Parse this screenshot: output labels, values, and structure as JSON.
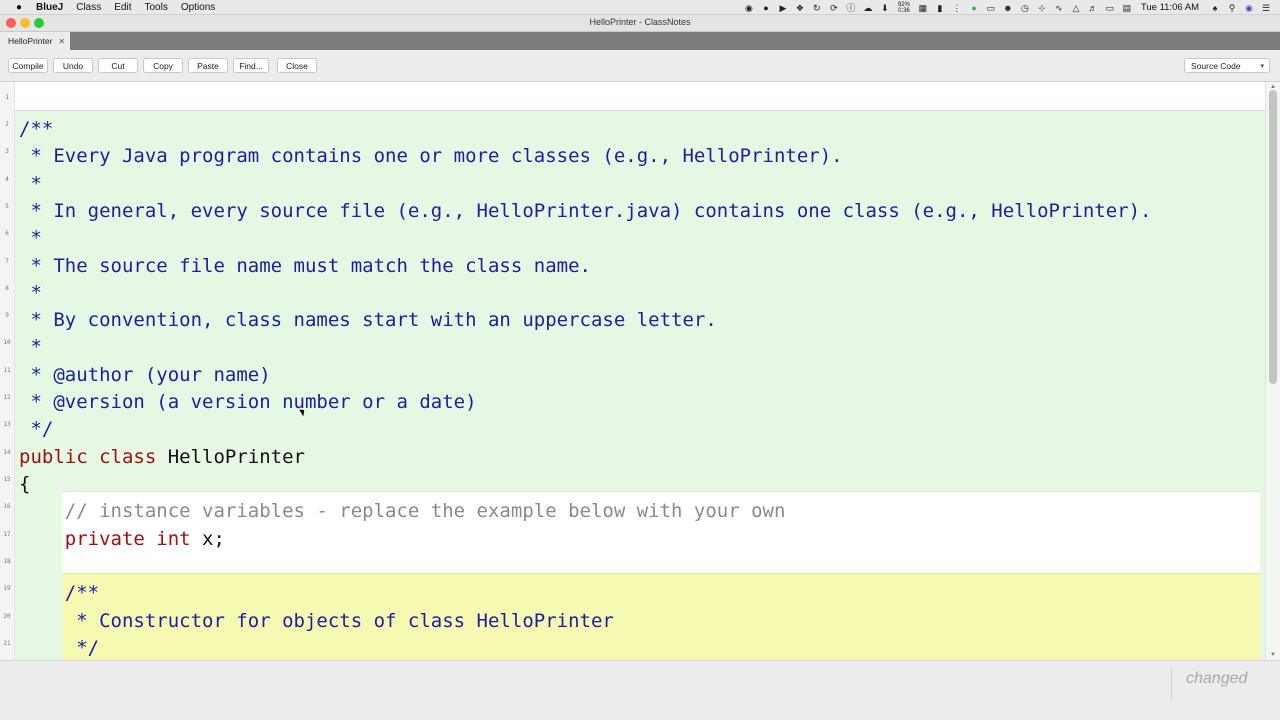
{
  "menubar": {
    "apple_symbol": "●",
    "items": [
      "BlueJ",
      "Class",
      "Edit",
      "Tools",
      "Options"
    ],
    "battery_percent": "92%",
    "battery_time": "0:36",
    "clock": "Tue 11:06 AM"
  },
  "window": {
    "title": "HelloPrinter - ClassNotes",
    "traffic_colors": [
      "#fc5f57",
      "#fdbc2e",
      "#28c840"
    ]
  },
  "tab": {
    "label": "HelloPrinter",
    "close_symbol": "✕"
  },
  "toolbar": {
    "compile": "Compile",
    "undo": "Undo",
    "cut": "Cut",
    "copy": "Copy",
    "paste": "Paste",
    "find": "Find...",
    "close": "Close",
    "view_select": "Source Code"
  },
  "editor": {
    "line_numbers": [
      "1",
      "2",
      "3",
      "4",
      "5",
      "6",
      "7",
      "8",
      "9",
      "10",
      "11",
      "12",
      "13",
      "14",
      "15",
      "16",
      "17",
      "18",
      "19",
      "20",
      "21"
    ],
    "lines": [
      {
        "parts": [
          {
            "text": "",
            "cls": "c-plain"
          }
        ]
      },
      {
        "parts": [
          {
            "text": "/**",
            "cls": "c-doc"
          }
        ]
      },
      {
        "parts": [
          {
            "text": " * Every Java program contains one or more classes (e.g., HelloPrinter).",
            "cls": "c-doc"
          }
        ]
      },
      {
        "parts": [
          {
            "text": " *",
            "cls": "c-doc"
          }
        ]
      },
      {
        "parts": [
          {
            "text": " * In general, every source file (e.g., HelloPrinter.java) contains one class (e.g., HelloPrinter).",
            "cls": "c-doc"
          }
        ]
      },
      {
        "parts": [
          {
            "text": " *",
            "cls": "c-doc"
          }
        ]
      },
      {
        "parts": [
          {
            "text": " * The source file name must match the class name.",
            "cls": "c-doc"
          }
        ]
      },
      {
        "parts": [
          {
            "text": " *",
            "cls": "c-doc"
          }
        ]
      },
      {
        "parts": [
          {
            "text": " * By convention, class names start with an uppercase letter.",
            "cls": "c-doc"
          }
        ]
      },
      {
        "parts": [
          {
            "text": " *",
            "cls": "c-doc"
          }
        ]
      },
      {
        "parts": [
          {
            "text": " * @author (your name)",
            "cls": "c-doc"
          }
        ]
      },
      {
        "parts": [
          {
            "text": " * @version (a version number or a date)",
            "cls": "c-doc"
          }
        ]
      },
      {
        "parts": [
          {
            "text": " */",
            "cls": "c-doc"
          }
        ]
      },
      {
        "parts": [
          {
            "text": "public ",
            "cls": "c-kw"
          },
          {
            "text": "class ",
            "cls": "c-kw"
          },
          {
            "text": "HelloPrinter",
            "cls": "c-plain"
          }
        ]
      },
      {
        "parts": [
          {
            "text": "{",
            "cls": "c-plain"
          }
        ]
      },
      {
        "parts": [
          {
            "text": "    // instance variables - replace the example below with your own",
            "cls": "c-cmt"
          }
        ]
      },
      {
        "parts": [
          {
            "text": "    ",
            "cls": "c-plain"
          },
          {
            "text": "private ",
            "cls": "c-kw"
          },
          {
            "text": "int ",
            "cls": "c-kw"
          },
          {
            "text": "x;",
            "cls": "c-plain"
          }
        ]
      },
      {
        "parts": [
          {
            "text": "",
            "cls": "c-plain"
          }
        ]
      },
      {
        "parts": [
          {
            "text": "    /**",
            "cls": "c-doc"
          }
        ]
      },
      {
        "parts": [
          {
            "text": "     * Constructor for objects of class HelloPrinter",
            "cls": "c-doc"
          }
        ]
      },
      {
        "parts": [
          {
            "text": "     */",
            "cls": "c-doc"
          }
        ]
      }
    ]
  },
  "status": {
    "text": "changed"
  }
}
